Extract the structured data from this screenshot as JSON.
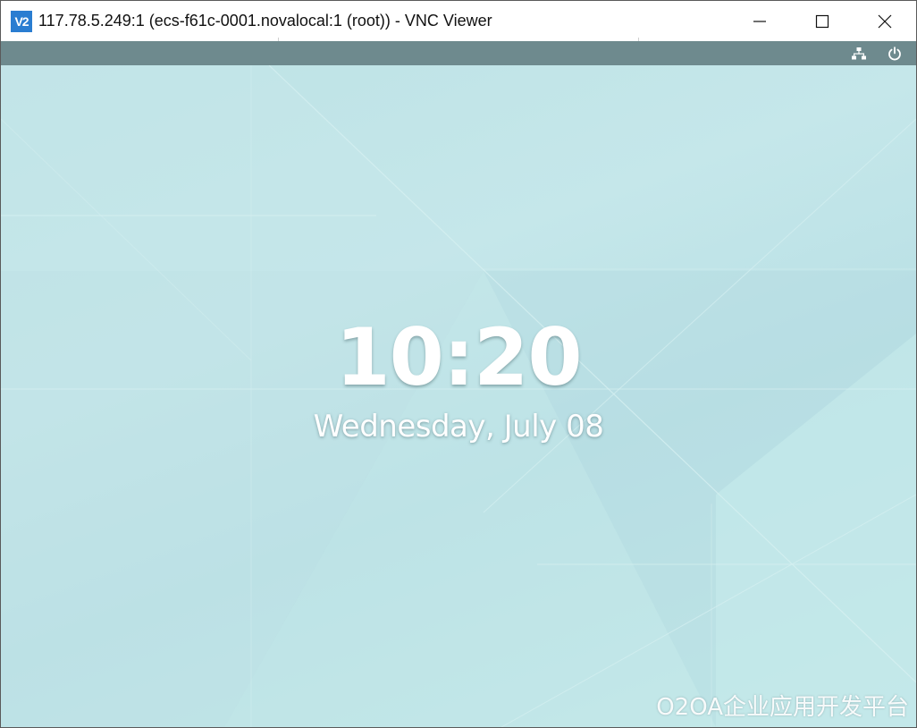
{
  "window": {
    "title": "117.78.5.249:1 (ecs-f61c-0001.novalocal:1 (root)) - VNC Viewer",
    "app_icon": "vnc-viewer-icon",
    "app_icon_text": "V2",
    "controls": [
      "minimize-icon",
      "maximize-icon",
      "close-icon"
    ]
  },
  "topbar": {
    "icons": [
      "network-wired-icon",
      "power-icon"
    ],
    "background_color": "#6e8a8e"
  },
  "lock_screen": {
    "time": "10:20",
    "date": "Wednesday, July 08"
  },
  "watermark": {
    "text": "O2OA企业应用开发平台"
  },
  "colors": {
    "app_icon_bg": "#2a7dd1",
    "desktop_bg": "#bfe3e6",
    "text": "#ffffff"
  }
}
